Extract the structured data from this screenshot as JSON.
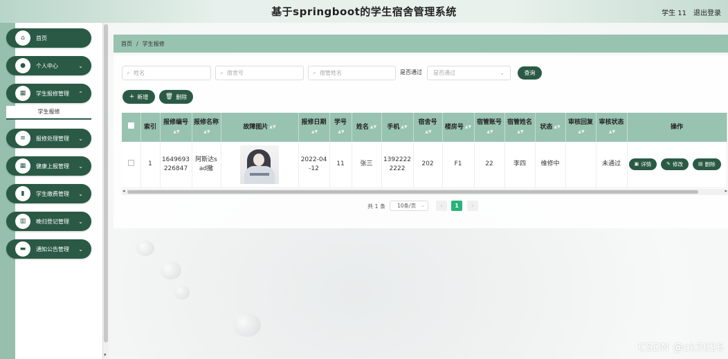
{
  "header": {
    "title": "基于springboot的学生宿舍管理系统",
    "user": "学生 11",
    "logout": "退出登录"
  },
  "sidebar": {
    "items": [
      {
        "label": "首页",
        "icon": "home-icon",
        "has_chevron": false
      },
      {
        "label": "个人中心",
        "icon": "user-icon",
        "has_chevron": true
      },
      {
        "label": "学生报修管理",
        "icon": "grid-icon",
        "has_chevron": true,
        "expanded": true
      },
      {
        "label": "报修处理管理",
        "icon": "list-icon",
        "has_chevron": true
      },
      {
        "label": "健康上报管理",
        "icon": "grid-icon",
        "has_chevron": true
      },
      {
        "label": "学生缴费管理",
        "icon": "chart-icon",
        "has_chevron": true
      },
      {
        "label": "晚归登记管理",
        "icon": "calendar-icon",
        "has_chevron": true
      },
      {
        "label": "通知公告管理",
        "icon": "message-icon",
        "has_chevron": true
      }
    ],
    "submenu_active": "学生报修"
  },
  "breadcrumb": {
    "home": "首页",
    "separator": "/",
    "current": "学生报修"
  },
  "search": {
    "name_placeholder": "姓名",
    "dorm_placeholder": "宿舍号",
    "manager_placeholder": "宿管姓名",
    "filter_label": "是否通过",
    "filter_placeholder": "是否通过",
    "query_button": "查询"
  },
  "actions": {
    "add": "新增",
    "delete": "删除"
  },
  "table": {
    "columns": [
      "索引",
      "报修编号",
      "报修名称",
      "故障图片",
      "报修日期",
      "学号",
      "姓名",
      "手机",
      "宿舍号",
      "楼房号",
      "宿管账号",
      "宿管姓名",
      "状态",
      "审核回复",
      "审核状态",
      "操作"
    ],
    "rows": [
      {
        "index": "1",
        "repair_no": "1649693226847",
        "repair_name": "阿斯达sad撒",
        "date": "2022-04-12",
        "student_no": "11",
        "name": "张三",
        "phone": "13922222222",
        "dorm_no": "202",
        "building_no": "F1",
        "manager_account": "22",
        "manager_name": "李四",
        "status": "维修中",
        "review_reply": "",
        "review_status": "未通过",
        "ops": {
          "detail": "详情",
          "edit": "修改",
          "delete": "删除"
        }
      }
    ]
  },
  "pagination": {
    "total": "共 1 条",
    "page_size": "10条/页",
    "current_page": "1"
  },
  "watermark": "CSDN @ck3026",
  "colors": {
    "primary": "#2a5a45",
    "header_bg": "#98c3b0",
    "active_page": "#27b37a"
  }
}
